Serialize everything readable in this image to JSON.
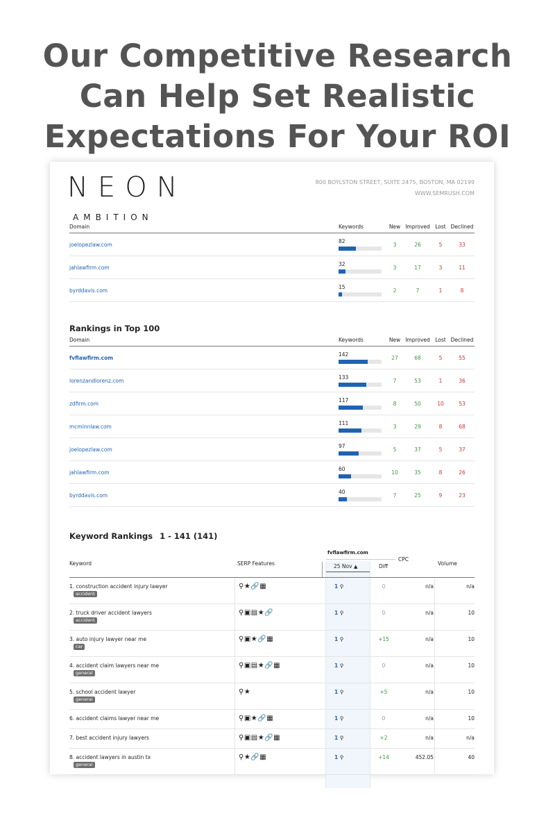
{
  "headline": {
    "line1": "Our Competitive Research",
    "line2": "Can Help Set Realistic",
    "line3": "Expectations For Your ROI"
  },
  "logo": {
    "main": "NEON",
    "sub": "AMBITION"
  },
  "address": {
    "street": "800 BOYLSTON STREET, SUITE 2475, BOSTON, MA 02199",
    "web": "WWW.SEMRUSH.COM"
  },
  "columns": {
    "domain": "Domain",
    "keywords": "Keywords",
    "new": "New",
    "improved": "Improved",
    "lost": "Lost",
    "declined": "Declined"
  },
  "table1": {
    "rows": [
      {
        "domain": "joelopezlaw.com",
        "keywords": "82",
        "new": "3",
        "improved": "26",
        "lost": "5",
        "declined": "33",
        "fill": 0.4
      },
      {
        "domain": "jahlawfirm.com",
        "keywords": "32",
        "new": "3",
        "improved": "17",
        "lost": "3",
        "declined": "11",
        "fill": 0.16
      },
      {
        "domain": "byrddavis.com",
        "keywords": "15",
        "new": "2",
        "improved": "7",
        "lost": "1",
        "declined": "8",
        "fill": 0.08
      }
    ]
  },
  "table2": {
    "title": "Rankings in Top 100",
    "rows": [
      {
        "domain": "fvflawfirm.com",
        "keywords": "142",
        "new": "27",
        "improved": "68",
        "lost": "5",
        "declined": "55",
        "fill": 0.68,
        "bold": true
      },
      {
        "domain": "lorenzandlorenz.com",
        "keywords": "133",
        "new": "7",
        "improved": "53",
        "lost": "1",
        "declined": "36",
        "fill": 0.64
      },
      {
        "domain": "zdfirm.com",
        "keywords": "117",
        "new": "8",
        "improved": "50",
        "lost": "10",
        "declined": "53",
        "fill": 0.56
      },
      {
        "domain": "mcminnlaw.com",
        "keywords": "111",
        "new": "3",
        "improved": "29",
        "lost": "8",
        "declined": "68",
        "fill": 0.53
      },
      {
        "domain": "joelopezlaw.com",
        "keywords": "97",
        "new": "5",
        "improved": "37",
        "lost": "5",
        "declined": "37",
        "fill": 0.47
      },
      {
        "domain": "jahlawfirm.com",
        "keywords": "60",
        "new": "10",
        "improved": "35",
        "lost": "8",
        "declined": "26",
        "fill": 0.29
      },
      {
        "domain": "byrddavis.com",
        "keywords": "40",
        "new": "7",
        "improved": "25",
        "lost": "9",
        "declined": "23",
        "fill": 0.19
      }
    ]
  },
  "keywords": {
    "title": "Keyword Rankings",
    "range": "1 - 141 (141)",
    "headers": {
      "keyword": "Keyword",
      "serp": "SERP Features",
      "domain": "fvflawfirm.com",
      "date": "25 Nov",
      "diff": "Diff",
      "cpc": "CPC",
      "volume": "Volume"
    },
    "rows": [
      {
        "keyword": "1. construction accident injury lawyer",
        "tag": "accident",
        "serp": "⚲★🔗▦",
        "rank": "1",
        "diff": "0",
        "cpc": "n/a",
        "volume": "n/a"
      },
      {
        "keyword": "2. truck driver accident lawyers",
        "tag": "accident",
        "serp": "⚲▣▤★🔗",
        "rank": "1",
        "diff": "0",
        "cpc": "n/a",
        "volume": "10"
      },
      {
        "keyword": "3. auto injury lawyer near me",
        "tag": "car",
        "serp": "⚲▣★🔗▦",
        "rank": "1",
        "diff": "+15",
        "cpc": "n/a",
        "volume": "10"
      },
      {
        "keyword": "4. accident claim lawyers near me",
        "tag": "general",
        "serp": "⚲▣▤★🔗▦",
        "rank": "1",
        "diff": "0",
        "cpc": "n/a",
        "volume": "10"
      },
      {
        "keyword": "5. school accident lawyer",
        "tag": "general",
        "serp": "⚲★",
        "rank": "1",
        "diff": "+5",
        "cpc": "n/a",
        "volume": "10"
      },
      {
        "keyword": "6. accident claims lawyer near me",
        "tag": "",
        "serp": "⚲▣★🔗▦",
        "rank": "1",
        "diff": "0",
        "cpc": "n/a",
        "volume": "10"
      },
      {
        "keyword": "7. best accident injury lawyers",
        "tag": "",
        "serp": "⚲▣▤★🔗▦",
        "rank": "1",
        "diff": "+2",
        "cpc": "n/a",
        "volume": "n/a"
      },
      {
        "keyword": "8. accident lawyers in austin tx",
        "tag": "general",
        "serp": "⚲★🔗▦",
        "rank": "1",
        "diff": "+14",
        "cpc": "452.05",
        "volume": "40"
      }
    ]
  },
  "colors": {
    "link": "#1f63b3",
    "positive": "#3a9a3a",
    "negative": "#d6332b",
    "headline": "#545454"
  }
}
